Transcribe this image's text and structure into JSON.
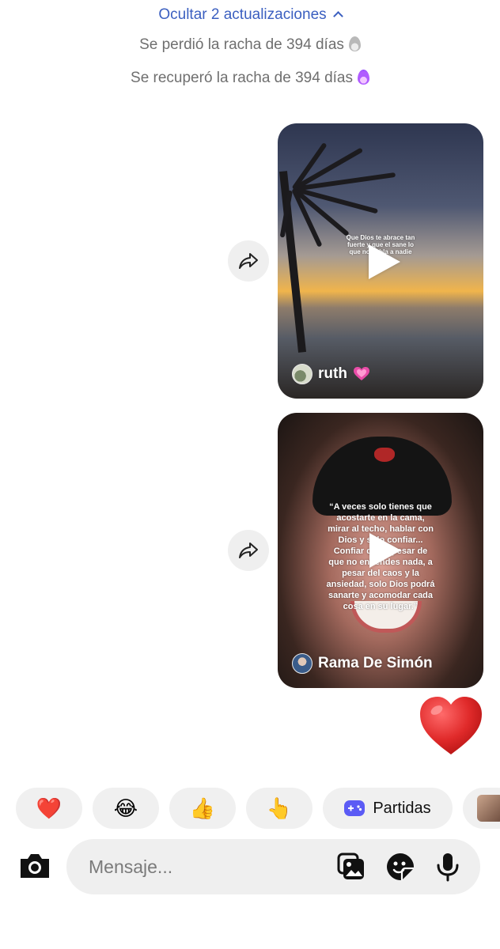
{
  "updates": {
    "toggle_label": "Ocultar 2 actualizaciones"
  },
  "system_messages": [
    {
      "text": "Se perdió la racha de 394 días",
      "icon": "gray-flame-icon"
    },
    {
      "text": "Se recuperó la racha de 394 días",
      "icon": "purple-flame-icon"
    }
  ],
  "reels": [
    {
      "author": "ruth",
      "caption": "Que Dios te abrace tan fuerte y que el sane lo que no habla a nadie",
      "badge": "pink-heart-icon"
    },
    {
      "author": "Rama De Simón",
      "caption": "“A veces solo tienes que acostarte en la cama, mirar al techo, hablar con Dios y solo confiar... Confiar que a pesar de que no entiendes nada, a pesar del caos y la ansiedad, solo Dios podrá sanarte y acomodar cada cosa en su lugar.”"
    }
  ],
  "reaction": {
    "icon": "red-heart-icon"
  },
  "quick_replies": {
    "emojis": [
      "❤️",
      "😂",
      "👍",
      "👆"
    ],
    "games_label": "Partidas"
  },
  "composer": {
    "placeholder": "Mensaje..."
  },
  "colors": {
    "link_blue": "#3b5fc0",
    "system_gray": "#6f6f6f",
    "pill_bg": "#f0f0f0",
    "games_purple": "#5b5bf5",
    "heart_red": "#e02a2a"
  }
}
